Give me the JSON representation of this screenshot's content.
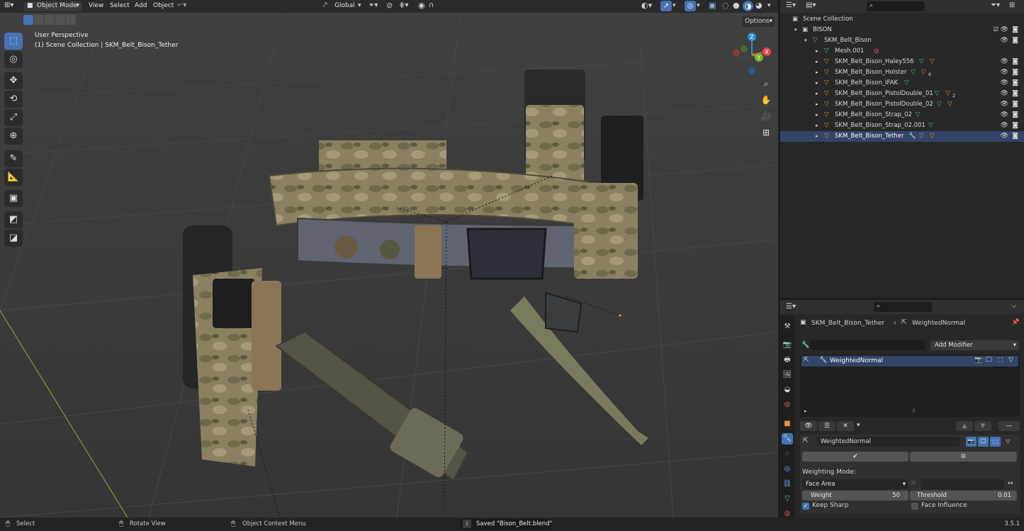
{
  "header": {
    "mode": "Object Mode",
    "menus": [
      "View",
      "Select",
      "Add",
      "Object"
    ],
    "transform_orientation": "Global",
    "options_label": "Options"
  },
  "viewport": {
    "perspective_label": "User Perspective",
    "context_label": "(1) Scene Collection | SKM_Belt_Bison_Tether",
    "gizmo_axes": {
      "x": "X",
      "y": "Y",
      "z": "Z"
    }
  },
  "outliner": {
    "root": "Scene Collection",
    "collection": "BISON",
    "parent": "SKM_Belt_Bison",
    "items": [
      {
        "label": "Mesh.001",
        "badge": ""
      },
      {
        "label": "SKM_Belt_Bison_Haley556",
        "badge": ""
      },
      {
        "label": "SKM_Belt_Bison_Holster",
        "badge": "6"
      },
      {
        "label": "SKM_Belt_Bison_IFAK",
        "badge": ""
      },
      {
        "label": "SKM_Belt_Bison_PistolDouble_01",
        "badge": "2"
      },
      {
        "label": "SKM_Belt_Bison_PistolDouble_02",
        "badge": ""
      },
      {
        "label": "SKM_Belt_Bison_Strap_02",
        "badge": ""
      },
      {
        "label": "SKM_Belt_Bison_Strap_02.001",
        "badge": ""
      },
      {
        "label": "SKM_Belt_Bison_Tether",
        "badge": ""
      }
    ]
  },
  "properties": {
    "breadcrumb_object": "SKM_Belt_Bison_Tether",
    "breadcrumb_modifier": "WeightedNormal",
    "add_modifier_label": "Add Modifier",
    "modifier_list_item": "WeightedNormal",
    "modifier_name": "WeightedNormal",
    "weighting_mode_label": "Weighting Mode:",
    "weighting_mode_value": "Face Area",
    "weight_label": "Weight",
    "weight_value": "50",
    "threshold_label": "Threshold",
    "threshold_value": "0.01",
    "keep_sharp_label": "Keep Sharp",
    "keep_sharp_checked": true,
    "face_influence_label": "Face Influence",
    "face_influence_checked": false
  },
  "statusbar": {
    "select_label": "Select",
    "rotate_label": "Rotate View",
    "context_menu_label": "Object Context Menu",
    "saved_message": "Saved \"Bison_Belt.blend\"",
    "version": "3.5.1"
  },
  "colors": {
    "accent_blue": "#4772b3",
    "mesh_orange": "#e8903c",
    "mesh_green": "#4fc1a4",
    "axis_x": "#e0474f",
    "axis_y": "#76b526",
    "axis_z": "#3a8cd4"
  }
}
